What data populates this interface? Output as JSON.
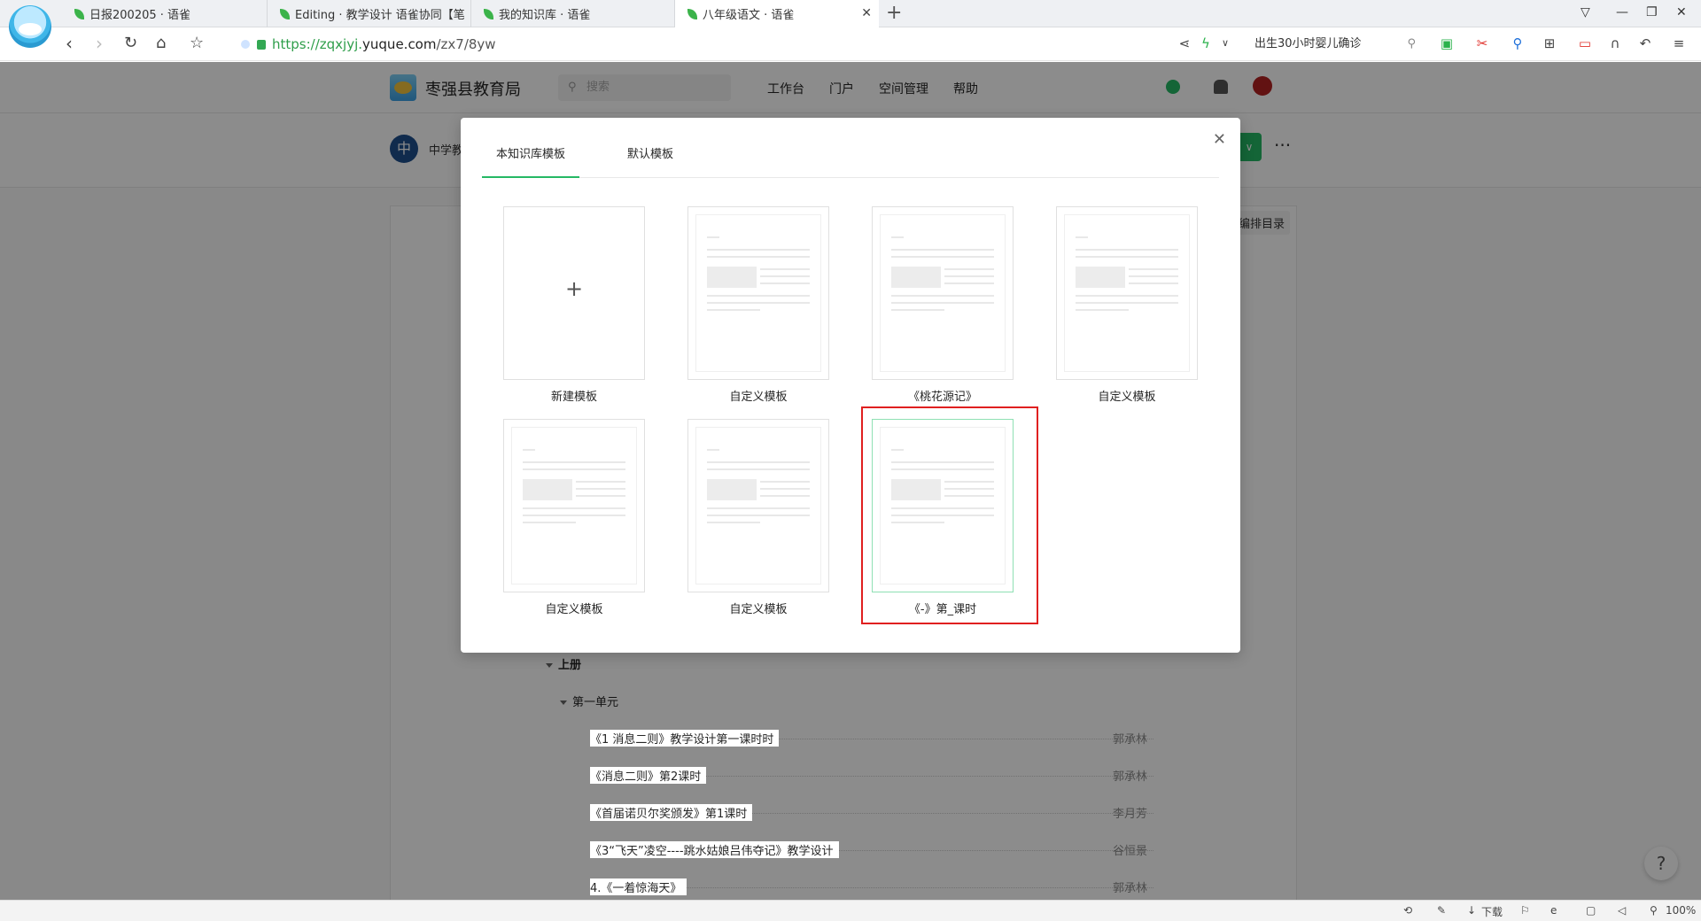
{
  "browser": {
    "tabs": [
      {
        "title": "日报200205 · 语雀"
      },
      {
        "title": "Editing · 教学设计 语雀协同【笔"
      },
      {
        "title": "我的知识库 · 语雀"
      },
      {
        "title": "八年级语文 · 语雀"
      }
    ],
    "address": {
      "url_prefix": "https://zqxjyj.",
      "url_domain": "yuque.com",
      "url_path": "/zx7/8yw"
    },
    "search_text": "出生30小时婴儿确诊",
    "zoom": "100%",
    "download_label": "下载"
  },
  "site": {
    "org_name": "枣强县教育局",
    "search_placeholder": "搜索",
    "nav": [
      "工作台",
      "门户",
      "空间管理",
      "帮助"
    ],
    "space_avatar": "中",
    "space_name": "中学教",
    "toc_edit": "编排目录"
  },
  "toc": {
    "group": "上册",
    "unit": "第一单元",
    "rows": [
      {
        "title": "《1 消息二则》教学设计第一课时时",
        "author": "郭承林"
      },
      {
        "title": "《消息二则》第2课时",
        "author": "郭承林"
      },
      {
        "title": "《首届诺贝尔奖颁发》第1课时",
        "author": "李月芳"
      },
      {
        "title": "《3“飞天”凌空----跳水姑娘吕伟夺记》教学设计",
        "author": "谷恒景"
      },
      {
        "title": "4.《一着惊海天》",
        "author": "郭承林"
      }
    ]
  },
  "modal": {
    "tabs": [
      "本知识库模板",
      "默认模板"
    ],
    "templates": [
      {
        "label": "新建模板",
        "kind": "new"
      },
      {
        "label": "自定义模板",
        "kind": "doc"
      },
      {
        "label": "《桃花源记》",
        "kind": "doc"
      },
      {
        "label": "自定义模板",
        "kind": "doc"
      },
      {
        "label": "自定义模板",
        "kind": "doc"
      },
      {
        "label": "自定义模板",
        "kind": "doc"
      },
      {
        "label": "《-》第_课时",
        "kind": "doc",
        "selected": true
      }
    ]
  },
  "colors": {
    "accent": "#25b864",
    "highlight": "#e02020"
  }
}
